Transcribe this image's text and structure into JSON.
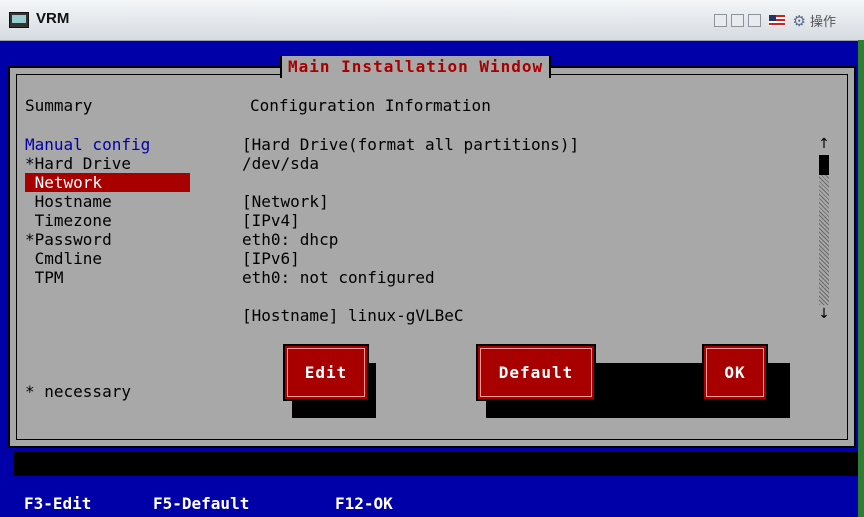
{
  "window": {
    "title": "VRM",
    "ops_label": "操作"
  },
  "dialog": {
    "title": "Main Installation Window",
    "summary_header": "Summary",
    "config_header": "Configuration Information",
    "menu": [
      {
        "label": "Manual config",
        "style": "blue"
      },
      {
        "label": "*Hard Drive",
        "style": "normal"
      },
      {
        "label": " Network",
        "style": "selected"
      },
      {
        "label": " Hostname",
        "style": "normal"
      },
      {
        "label": " Timezone",
        "style": "normal"
      },
      {
        "label": "*Password",
        "style": "normal"
      },
      {
        "label": " Cmdline",
        "style": "normal"
      },
      {
        "label": " TPM",
        "style": "normal"
      }
    ],
    "config_lines": [
      "[Hard Drive(format all partitions)]",
      "/dev/sda",
      "",
      "[Network]",
      "[IPv4]",
      "eth0: dhcp",
      "[IPv6]",
      "eth0: not configured",
      "",
      "[Hostname] linux-gVLBeC"
    ],
    "buttons": {
      "edit": "Edit",
      "default": "Default",
      "ok": "OK"
    },
    "footnote": "* necessary"
  },
  "scroll": {
    "up": "↑",
    "down": "↓"
  },
  "status_bar": {
    "f3": "F3-Edit",
    "f5": "F5-Default",
    "f12": "F12-OK"
  },
  "colors": {
    "console_blue": "#0000a8",
    "dialog_gray": "#a8a8a8",
    "accent_red": "#a80000"
  }
}
